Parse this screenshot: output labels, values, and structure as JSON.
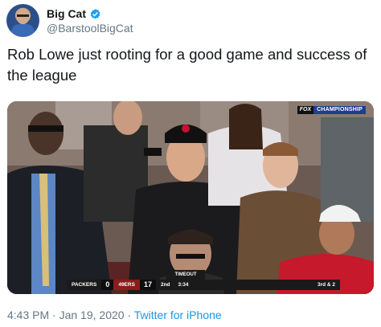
{
  "author": {
    "display_name": "Big Cat",
    "handle": "@BarstoolBigCat",
    "verified": true
  },
  "tweet": {
    "text": "Rob Lowe just rooting for a good game and success of the league"
  },
  "media": {
    "network": "FOX",
    "banner": "CHAMPIONSHIP",
    "scoreboard": {
      "timeout_label": "TIMEOUT",
      "team_a": "PACKERS",
      "score_a": "0",
      "team_b": "49ERS",
      "score_b": "17",
      "quarter": "2nd",
      "clock": "3:34",
      "down": "3rd & 2"
    }
  },
  "meta": {
    "time": "4:43 PM",
    "separator": "·",
    "date": "Jan 19, 2020",
    "source": "Twitter for iPhone"
  },
  "colors": {
    "text": "#14171a",
    "secondary": "#657786",
    "link": "#1b95e0",
    "verified": "#1da1f2"
  }
}
